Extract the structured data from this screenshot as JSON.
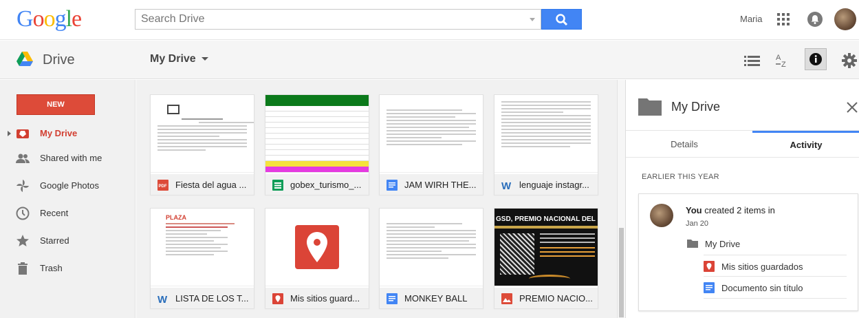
{
  "header": {
    "logo": "Google",
    "search_placeholder": "Search Drive",
    "user_name": "Maria"
  },
  "toolbar": {
    "app_name": "Drive",
    "location": "My Drive"
  },
  "sidebar": {
    "new_label": "NEW",
    "items": [
      {
        "label": "My Drive",
        "icon": "my-drive-icon"
      },
      {
        "label": "Shared with me",
        "icon": "shared-icon"
      },
      {
        "label": "Google Photos",
        "icon": "photos-icon"
      },
      {
        "label": "Recent",
        "icon": "clock-icon"
      },
      {
        "label": "Starred",
        "icon": "star-icon"
      },
      {
        "label": "Trash",
        "icon": "trash-icon"
      }
    ]
  },
  "files": [
    {
      "name": "Fiesta del agua ...",
      "type": "pdf",
      "icon_color": "#dd4b39"
    },
    {
      "name": "gobex_turismo_...",
      "type": "sheet",
      "icon_color": "#0f9d58"
    },
    {
      "name": "JAM WIRH THE...",
      "type": "doc",
      "icon_color": "#4285f4"
    },
    {
      "name": "lenguaje instagr...",
      "type": "word",
      "icon_color": "#2a6ebb"
    },
    {
      "name": "LISTA DE LOS T...",
      "type": "word",
      "icon_color": "#2a6ebb"
    },
    {
      "name": "Mis sitios guard...",
      "type": "map",
      "icon_color": "#db4437"
    },
    {
      "name": "MONKEY BALL",
      "type": "doc",
      "icon_color": "#4285f4"
    },
    {
      "name": "PREMIO NACIO...",
      "type": "image",
      "icon_color": "#dd4b39"
    }
  ],
  "thumb_texts": {
    "plaza": "PLAZA",
    "premio": "GSD, PREMIO NACIONAL DEL DEPOR"
  },
  "panel": {
    "title": "My Drive",
    "tabs": [
      "Details",
      "Activity"
    ],
    "active_tab": "Activity",
    "section": "EARLIER THIS YEAR",
    "activity": {
      "actor": "You",
      "action": " created 2 items in",
      "date": "Jan 20",
      "folder": "My Drive",
      "items": [
        {
          "label": "Mis sitios guardados",
          "type": "map"
        },
        {
          "label": "Documento sin título",
          "type": "doc"
        }
      ]
    }
  },
  "colors": {
    "new_button": "#dd4b39",
    "search_button": "#4285f4",
    "active_nav": "#d23f31",
    "tab_underline": "#4285f4"
  }
}
